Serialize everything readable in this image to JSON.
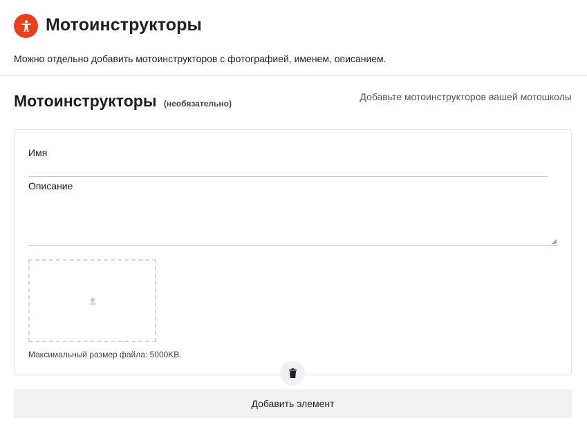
{
  "header": {
    "icon": "accessibility-person-icon",
    "title": "Мотоинструкторы",
    "description": "Можно отдельно добавить мотоинструкторов с фотографией, именем, описанием."
  },
  "section": {
    "title": "Мотоинструкторы",
    "optional_label": "(необязательно)",
    "hint": "Добавьте мотоинструкторов вашей мотошколы"
  },
  "form": {
    "name_label": "Имя",
    "description_label": "Описание",
    "upload_icon": "upload-arrow-icon",
    "max_file_note": "Максимальный размер файла: 5000KB."
  },
  "actions": {
    "delete_icon": "trash-icon",
    "add_label": "Добавить элемент"
  },
  "colors": {
    "accent": "#e8401c",
    "button_bg": "#f2f2f2"
  }
}
